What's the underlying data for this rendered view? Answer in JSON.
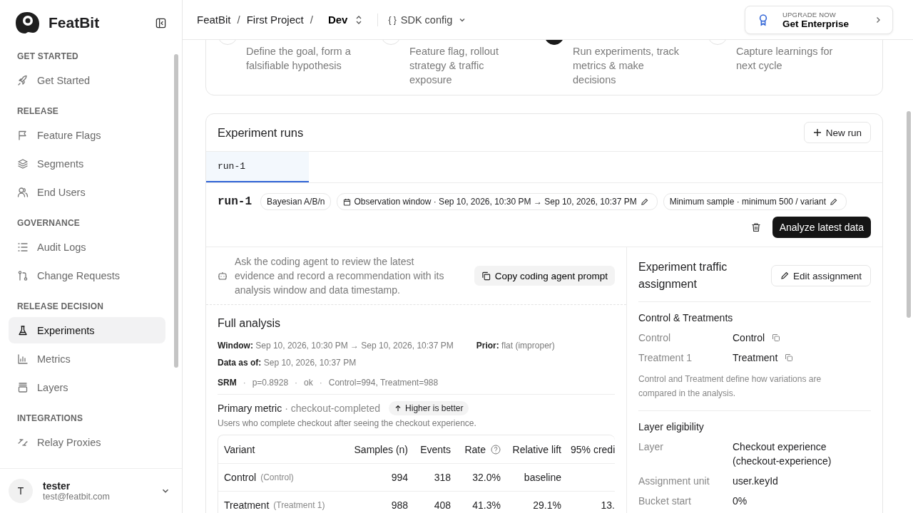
{
  "brand": {
    "name": "FeatBit"
  },
  "sidebar": {
    "sections": [
      {
        "title": "GET STARTED",
        "items": [
          {
            "label": "Get Started",
            "selected": false
          }
        ]
      },
      {
        "title": "RELEASE",
        "items": [
          {
            "label": "Feature Flags",
            "selected": false
          },
          {
            "label": "Segments",
            "selected": false
          },
          {
            "label": "End Users",
            "selected": false
          }
        ]
      },
      {
        "title": "GOVERNANCE",
        "items": [
          {
            "label": "Audit Logs",
            "selected": false
          },
          {
            "label": "Change Requests",
            "selected": false
          }
        ]
      },
      {
        "title": "RELEASE DECISION",
        "items": [
          {
            "label": "Experiments",
            "selected": true
          },
          {
            "label": "Metrics",
            "selected": false
          },
          {
            "label": "Layers",
            "selected": false
          }
        ]
      },
      {
        "title": "INTEGRATIONS",
        "items": [
          {
            "label": "Relay Proxies",
            "selected": false
          }
        ]
      }
    ],
    "user": {
      "avatar": "T",
      "name": "tester",
      "email": "test@featbit.com"
    }
  },
  "header": {
    "breadcrumbs": [
      "FeatBit",
      "First Project"
    ],
    "separator": "/",
    "environment": "Dev",
    "sdk_glyph": "{ }",
    "sdk_label": "SDK config",
    "upgrade": {
      "eyebrow": "UPGRADE NOW",
      "title": "Get Enterprise"
    }
  },
  "steps": [
    {
      "text": "Define the goal, form a falsifiable hypothesis",
      "current": false
    },
    {
      "text": "Feature flag, rollout strategy & traffic exposure",
      "current": false
    },
    {
      "text": "Run experiments, track metrics & make decisions",
      "current": true
    },
    {
      "text": "Capture learnings for next cycle",
      "current": false
    }
  ],
  "runs": {
    "title": "Experiment runs",
    "new_run": "New run",
    "tabs": [
      {
        "label": "run-1",
        "selected": true
      }
    ],
    "run": {
      "name": "run-1",
      "method": "Bayesian A/B/n",
      "observation": "Observation window · Sep 10, 2026, 10:30 PM → Sep 10, 2026, 10:37 PM",
      "minimum": "Minimum sample · minimum 500 / variant",
      "analyze": "Analyze latest data"
    },
    "agent": {
      "text": "Ask the coding agent to review the latest evidence and record a recommendation with its analysis window and data timestamp.",
      "button": "Copy coding agent prompt"
    },
    "analysis": {
      "title": "Full analysis",
      "window": {
        "label": "Window:",
        "value": "Sep 10, 2026, 10:30 PM → Sep 10, 2026, 10:37 PM"
      },
      "prior": {
        "label": "Prior:",
        "value": "flat (improper)"
      },
      "data_as_of": {
        "label": "Data as of:",
        "value": "Sep 10, 2026, 10:37 PM"
      },
      "srm": {
        "label": "SRM",
        "separator": "·",
        "parts": [
          "p=0.8928",
          "ok",
          "Control=994, Treatment=988"
        ]
      },
      "metric": {
        "label": "Primary metric",
        "name": "· checkout-completed",
        "badge": "Higher is better",
        "description": "Users who complete checkout after seeing the checkout experience."
      },
      "table": {
        "columns": [
          "Variant",
          "Samples (n)",
          "Events",
          "Rate",
          "Relative lift",
          "95% credi"
        ],
        "rows": [
          {
            "tag": "(Control)",
            "cells": [
              "Control",
              "994",
              "318",
              "32.0%",
              "baseline"
            ]
          },
          {
            "tag": "(Treatment 1)",
            "cells": [
              "Treatment",
              "988",
              "408",
              "41.3%",
              "29.1%",
              "13."
            ]
          }
        ]
      }
    },
    "assignment": {
      "title": "Experiment traffic assignment",
      "edit": "Edit assignment",
      "variants_title": "Control & Treatments",
      "variants": [
        {
          "label": "Control",
          "value": "Control"
        },
        {
          "label": "Treatment 1",
          "value": "Treatment"
        }
      ],
      "note": "Control and Treatment define how variations are compared in the analysis.",
      "layer_title": "Layer eligibility",
      "layer": [
        {
          "label": "Layer",
          "value": "Checkout experience (checkout-experience)"
        },
        {
          "label": "Assignment unit",
          "value": "user.keyId"
        },
        {
          "label": "Bucket start",
          "value": "0%"
        }
      ]
    }
  }
}
